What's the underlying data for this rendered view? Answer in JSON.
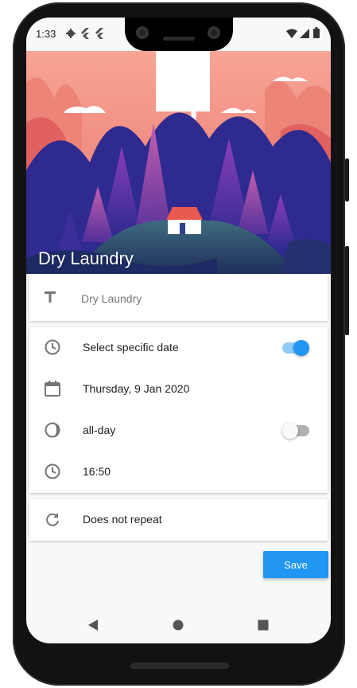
{
  "status_bar": {
    "time": "1:33"
  },
  "header": {
    "title": "Dry Laundry"
  },
  "title_field": {
    "value": "Dry Laundry"
  },
  "schedule": {
    "specific_date_label": "Select specific date",
    "specific_date_enabled": true,
    "date_label": "Thursday, 9 Jan 2020",
    "all_day_label": "all-day",
    "all_day_enabled": false,
    "time_label": "16:50"
  },
  "repeat": {
    "label": "Does not repeat"
  },
  "actions": {
    "save_label": "Save"
  },
  "colors": {
    "accent": "#2196f3",
    "icon_gray": "#757575",
    "surface": "#ffffff",
    "background": "#f8f8f8"
  },
  "icons": [
    "settings-icon",
    "flutter-icon",
    "wifi-icon",
    "signal-icon",
    "battery-icon",
    "text-icon",
    "clock-icon",
    "calendar-icon",
    "half-moon-icon",
    "repeat-icon",
    "back-icon",
    "home-icon",
    "recents-icon"
  ]
}
